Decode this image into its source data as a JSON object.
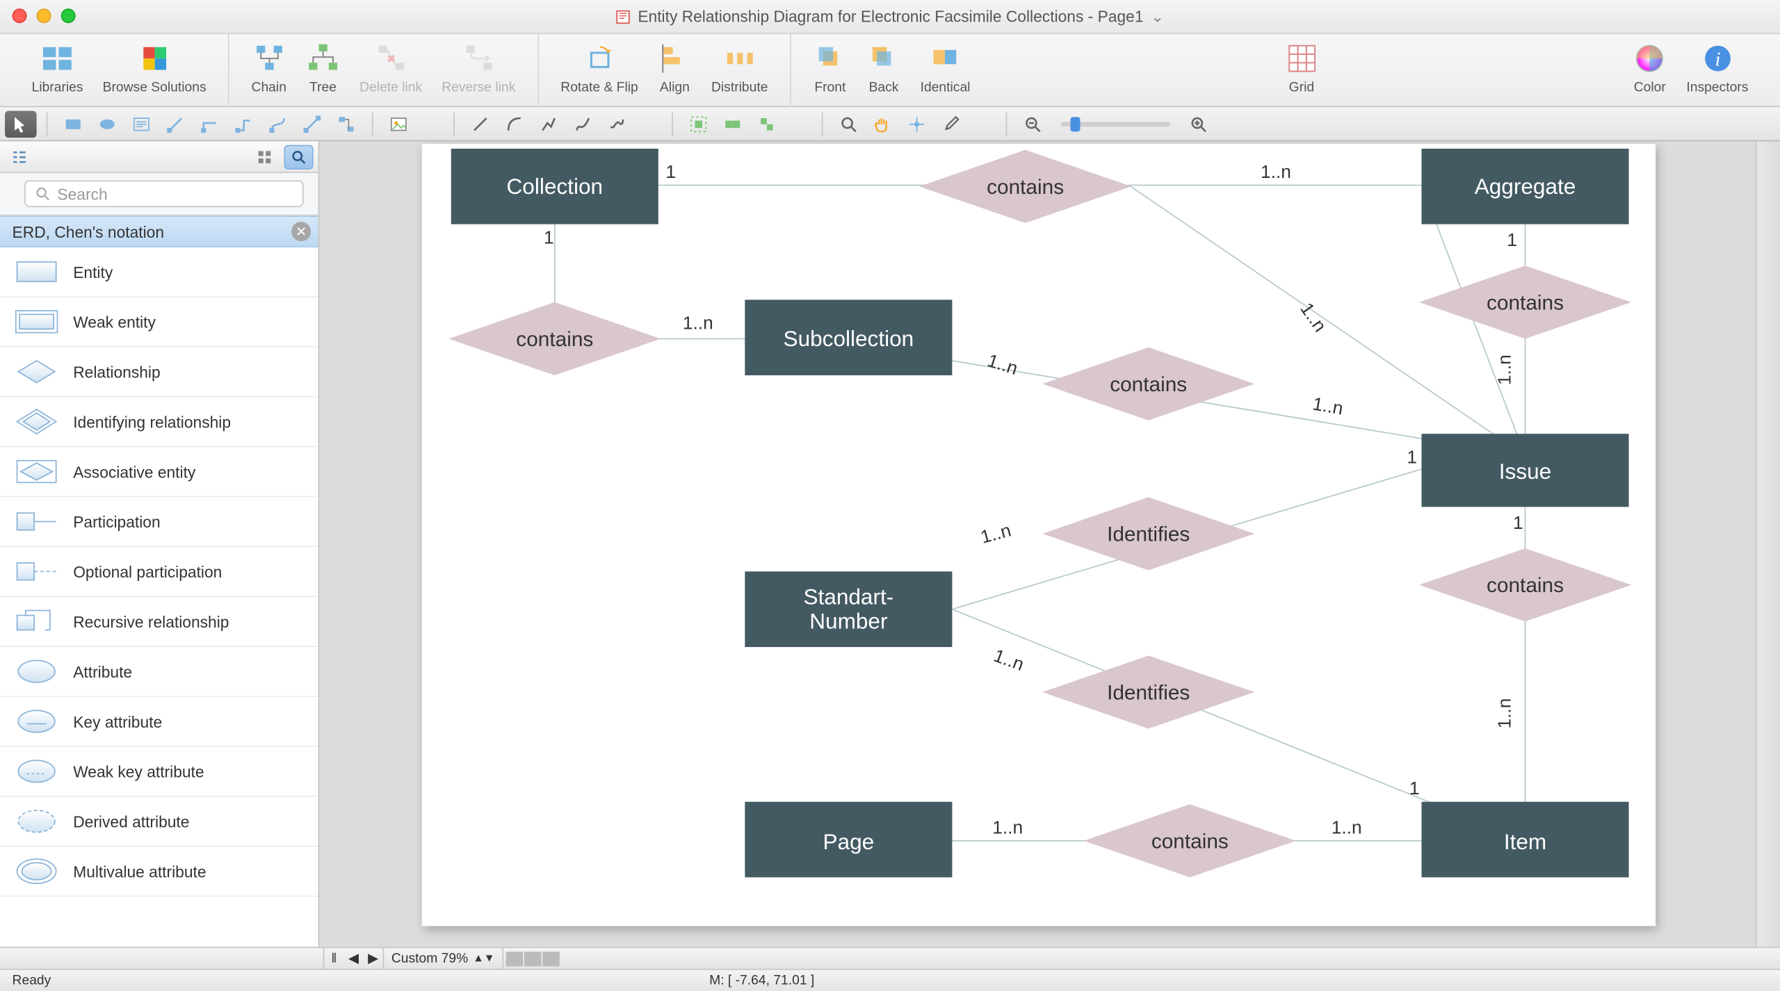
{
  "window": {
    "title": "Entity Relationship Diagram for Electronic Facsimile Collections - Page1"
  },
  "toolbar": {
    "libraries": "Libraries",
    "browse": "Browse Solutions",
    "chain": "Chain",
    "tree": "Tree",
    "delete_link": "Delete link",
    "reverse_link": "Reverse link",
    "rotate_flip": "Rotate & Flip",
    "align": "Align",
    "distribute": "Distribute",
    "front": "Front",
    "back": "Back",
    "identical": "Identical",
    "grid": "Grid",
    "color": "Color",
    "inspectors": "Inspectors"
  },
  "sidebar": {
    "search_placeholder": "Search",
    "library_title": "ERD, Chen's notation",
    "shapes": [
      {
        "label": "Entity"
      },
      {
        "label": "Weak entity"
      },
      {
        "label": "Relationship"
      },
      {
        "label": "Identifying relationship"
      },
      {
        "label": "Associative entity"
      },
      {
        "label": "Participation"
      },
      {
        "label": "Optional participation"
      },
      {
        "label": "Recursive relationship"
      },
      {
        "label": "Attribute"
      },
      {
        "label": "Key attribute"
      },
      {
        "label": "Weak key attribute"
      },
      {
        "label": "Derived attribute"
      },
      {
        "label": "Multivalue attribute"
      }
    ]
  },
  "diagram": {
    "entities": {
      "collection": "Collection",
      "aggregate": "Aggregate",
      "subcollection": "Subcollection",
      "issue": "Issue",
      "standartnumber_l1": "Standart-",
      "standartnumber_l2": "Number",
      "page": "Page",
      "item": "Item"
    },
    "relationships": {
      "contains1": "contains",
      "contains2": "contains",
      "contains3": "contains",
      "contains4": "contains",
      "contains5": "contains",
      "contains6": "contains",
      "identifies1": "Identifies",
      "identifies2": "Identifies"
    },
    "card": {
      "one": "1",
      "many": "1..n"
    }
  },
  "pagebar": {
    "zoom_label": "Custom 79%"
  },
  "status": {
    "left": "Ready",
    "coords": "M: [ -7.64, 71.01 ]"
  }
}
